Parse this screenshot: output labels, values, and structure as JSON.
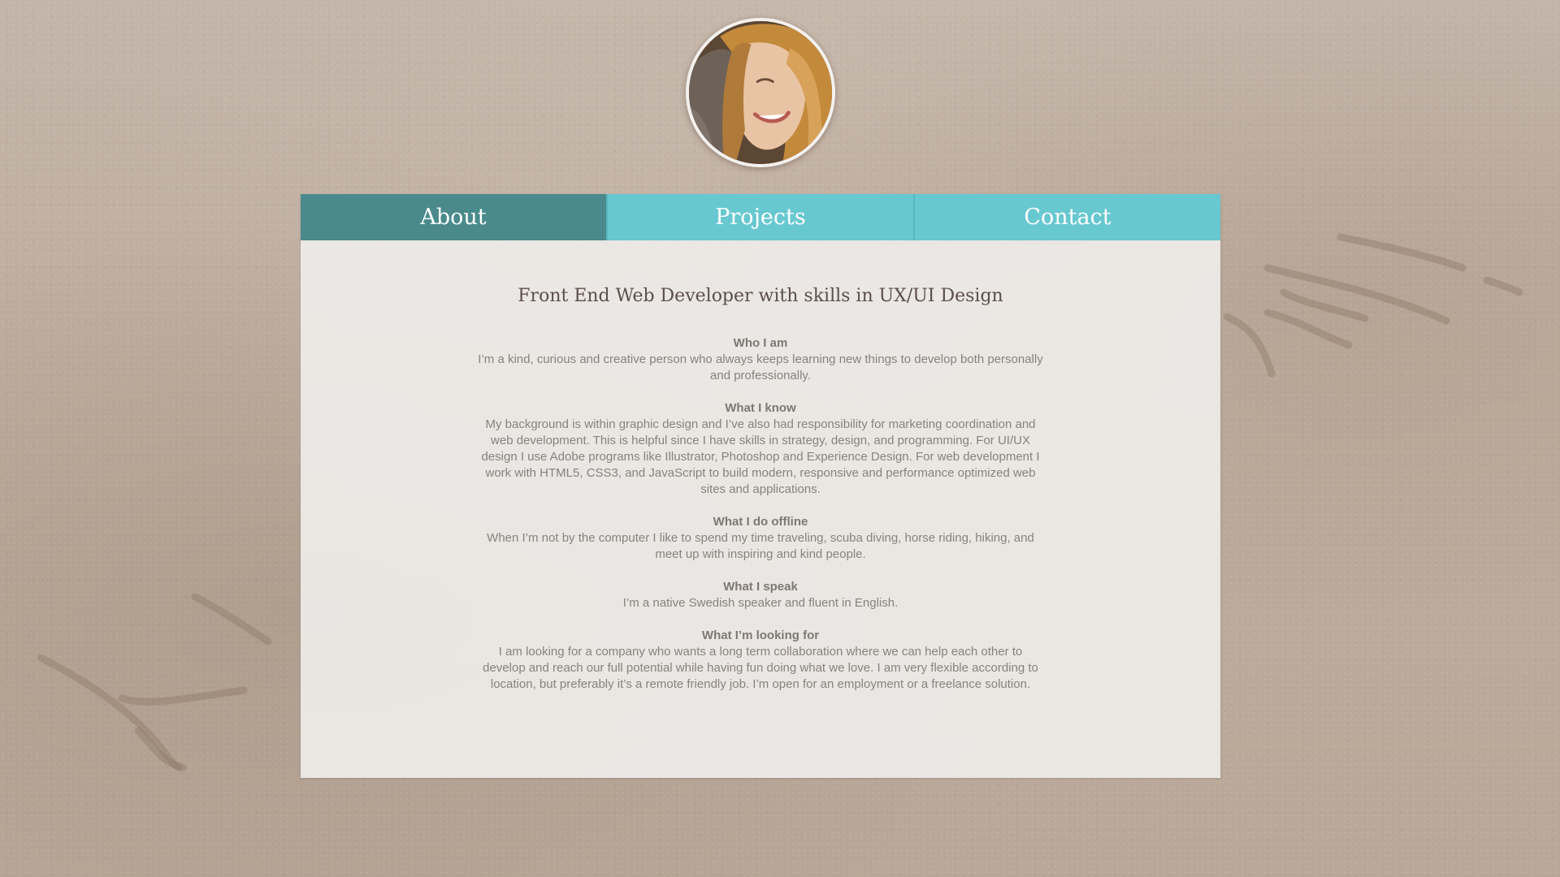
{
  "profile": {
    "avatar_alt": "Profile photo"
  },
  "nav": {
    "tabs": [
      {
        "label": "About",
        "active": true
      },
      {
        "label": "Projects",
        "active": false
      },
      {
        "label": "Contact",
        "active": false
      }
    ]
  },
  "about": {
    "headline": "Front End Web Developer with skills in UX/UI Design",
    "sections": [
      {
        "heading": "Who I am",
        "body": "I’m a kind, curious and creative person  who always keeps learning new things to develop both personally and professionally."
      },
      {
        "heading": "What I know",
        "body": "My background is within graphic design and I’ve also had responsibility for marketing coordination and web development. This is helpful since I have skills in strategy, design, and programming. For UI/UX design I use Adobe programs like Illustrator, Photoshop and Experience Design. For web development I work with HTML5, CSS3, and JavaScript to build modern, responsive and performance optimized web sites and applications."
      },
      {
        "heading": "What I do offline",
        "body": "When I’m not by the computer I like to spend my time traveling, scuba diving, horse riding, hiking, and meet up with inspiring and kind people."
      },
      {
        "heading": "What I speak",
        "body": "I’m a native Swedish speaker and fluent in English."
      },
      {
        "heading": "What I’m looking for",
        "body": "I am looking for a company who wants a long term collaboration where we can help each other to develop and reach our full potential while having fun doing what we love. I am very flexible according to location, but preferably it’s a remote friendly job. I’m open for an employment or a freelance solution."
      }
    ]
  },
  "colors": {
    "tab_active": "#4a8a8c",
    "tab_inactive": "#68c8d0",
    "headline": "#5c4f49",
    "body_text": "#87827d"
  }
}
